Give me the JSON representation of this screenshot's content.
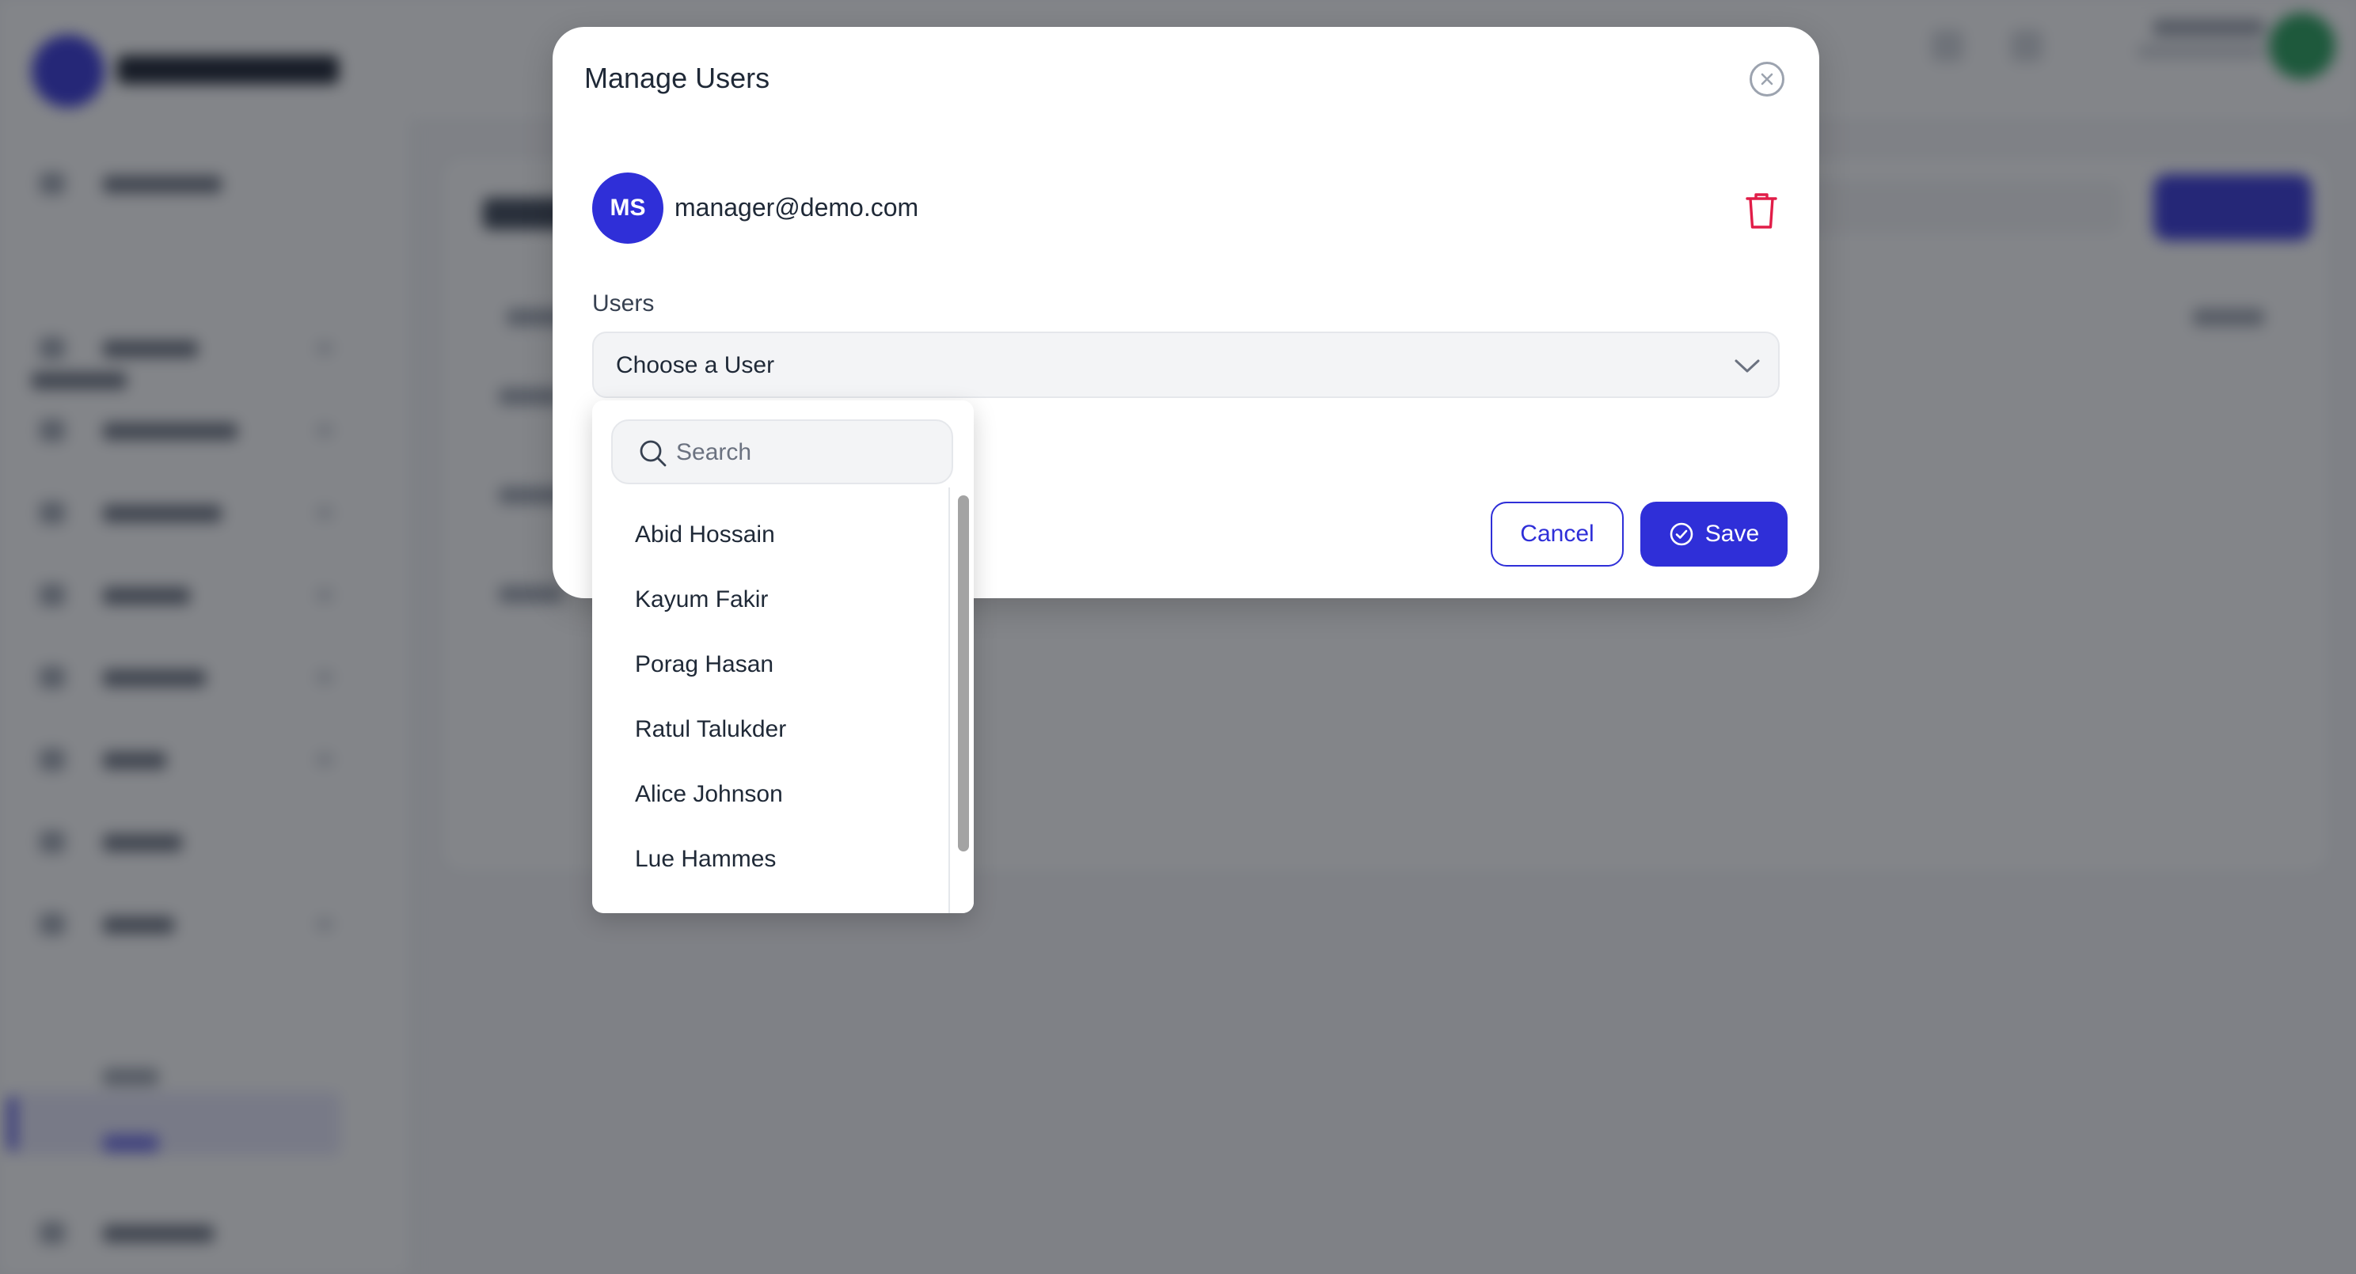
{
  "modal": {
    "title": "Manage Users",
    "manager": {
      "initials": "MS",
      "email": "manager@demo.com"
    },
    "users_label": "Users",
    "select_placeholder": "Choose a User",
    "cancel_label": "Cancel",
    "save_label": "Save"
  },
  "dropdown": {
    "search_placeholder": "Search",
    "options": [
      "Abid Hossain",
      "Kayum Fakir",
      "Porag Hasan",
      "Ratul Talukder",
      "Alice Johnson",
      "Lue Hammes"
    ]
  },
  "colors": {
    "accent": "#2f2fd8",
    "danger": "#e11d48",
    "overlay": "rgba(30,33,40,0.55)"
  },
  "icons": [
    "close-icon",
    "trash-icon",
    "chevron-down-icon",
    "search-icon",
    "check-circle-icon"
  ]
}
